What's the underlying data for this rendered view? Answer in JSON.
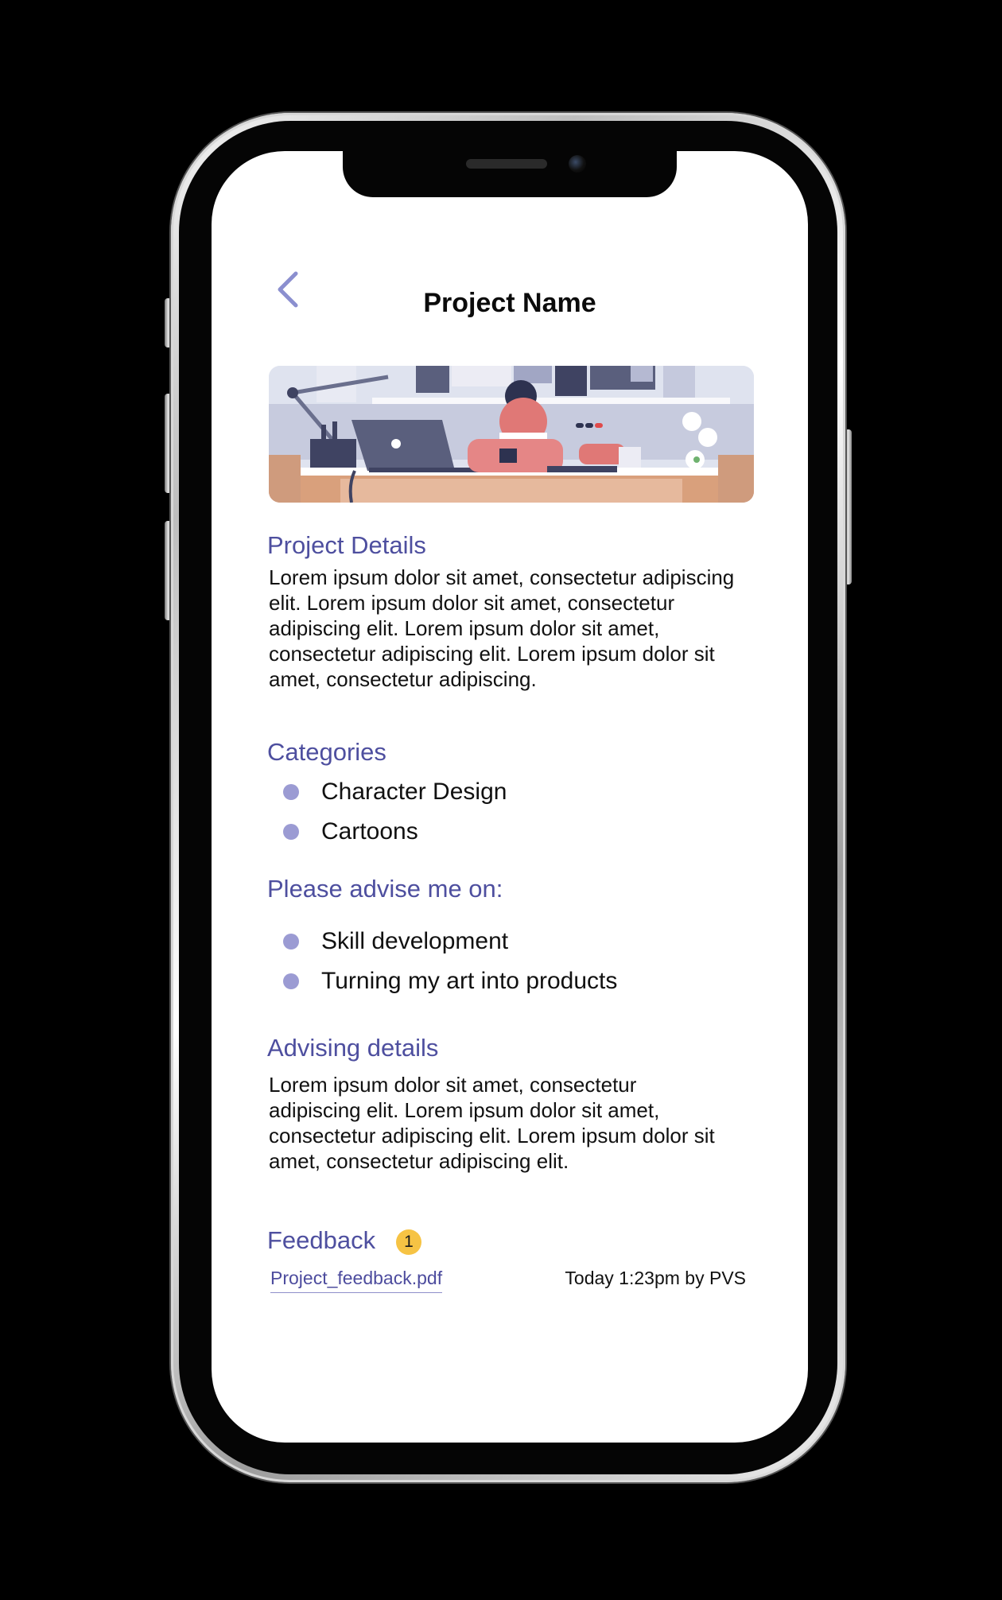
{
  "header": {
    "title": "Project Name"
  },
  "sections": {
    "project_details": {
      "heading": "Project Details",
      "body": "Lorem ipsum dolor sit amet, consectetur adipiscing elit.  Lorem ipsum dolor sit amet, consectetur adipiscing elit. Lorem ipsum dolor sit amet, consectetur adipiscing elit. Lorem ipsum dolor sit amet, consectetur adipiscing."
    },
    "categories": {
      "heading": "Categories",
      "items": [
        "Character Design",
        "Cartoons"
      ]
    },
    "advise": {
      "heading": "Please advise me on:",
      "items": [
        "Skill development",
        "Turning my art into products"
      ]
    },
    "advising_details": {
      "heading": "Advising details",
      "body": "Lorem ipsum dolor sit amet, consectetur adipiscing elit.  Lorem ipsum dolor sit amet, consectetur adipiscing elit. Lorem ipsum dolor sit amet, consectetur adipiscing elit."
    },
    "feedback": {
      "heading": "Feedback",
      "badge_count": "1",
      "file_name": "Project_feedback.pdf",
      "meta": "Today 1:23pm by PVS"
    }
  },
  "icons": {
    "back": "chevron-left-icon",
    "bullet": "bullet-dot-icon"
  },
  "colors": {
    "accent": "#4e4f9f",
    "bullet": "#9b9bd3",
    "badge": "#f6c344",
    "background": "#ffffff"
  }
}
